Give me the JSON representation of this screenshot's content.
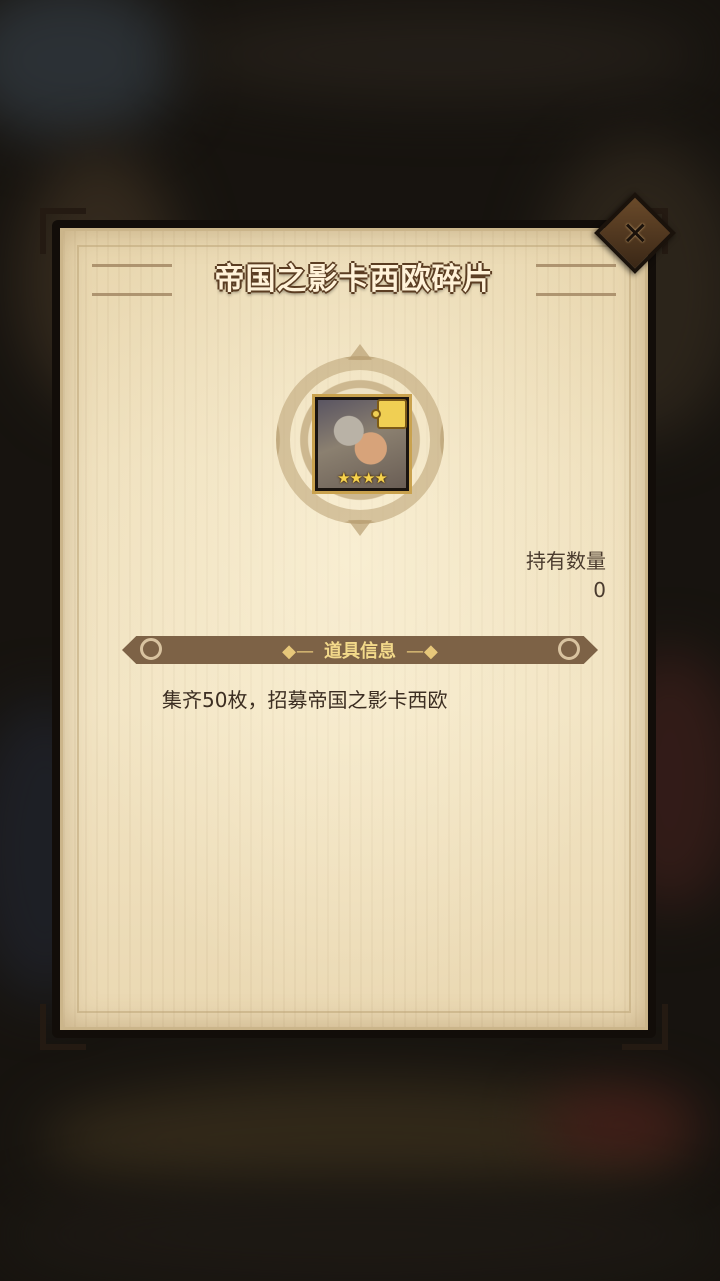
{
  "dialog": {
    "title": "帝国之影卡西欧碎片",
    "close_icon": "close-icon",
    "owned_label": "持有数量",
    "owned_value": "0",
    "section_title": "道具信息",
    "description": "集齐50枚，招募帝国之影卡西欧"
  },
  "item": {
    "stars": "★★★★",
    "star_count": 4,
    "icon_badge": "puzzle-icon",
    "icon_name": "hero-portrait-icon"
  },
  "colors": {
    "parchment": "#efe0bd",
    "frame": "#120d09",
    "section_bar": "#7d6246",
    "section_text": "#f3d98a",
    "title_text": "#fff2d8",
    "star": "#f6d24d"
  }
}
